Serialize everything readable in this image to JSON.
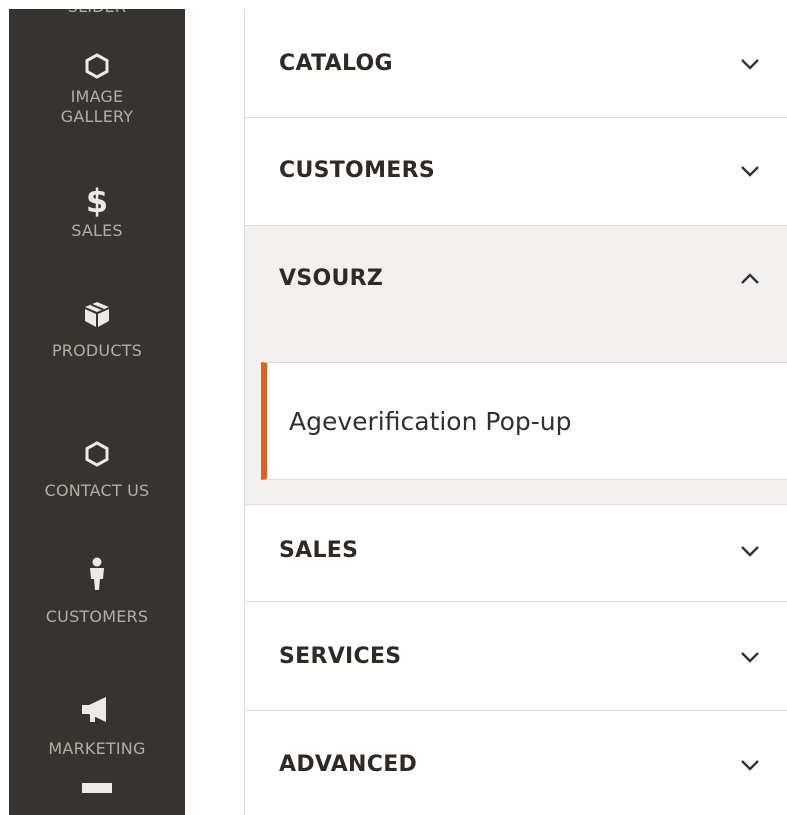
{
  "sidebar": {
    "items": [
      {
        "label": "SLIDER",
        "icon": "hexagon-icon"
      },
      {
        "label": "IMAGE GALLERY",
        "icon": "hexagon-icon"
      },
      {
        "label": "SALES",
        "icon": "dollar-icon"
      },
      {
        "label": "PRODUCTS",
        "icon": "box-icon"
      },
      {
        "label": "CONTACT US",
        "icon": "hexagon-icon"
      },
      {
        "label": "CUSTOMERS",
        "icon": "person-icon"
      },
      {
        "label": "MARKETING",
        "icon": "megaphone-icon"
      }
    ],
    "dollar_glyph": "$",
    "background": "#373330"
  },
  "config": {
    "sections": [
      {
        "title": "CATALOG",
        "expanded": false
      },
      {
        "title": "CUSTOMERS",
        "expanded": false
      },
      {
        "title": "VSOURZ",
        "expanded": true,
        "children": [
          {
            "label": "Ageverification Pop-up",
            "active": true
          }
        ]
      },
      {
        "title": "SALES",
        "expanded": false
      },
      {
        "title": "SERVICES",
        "expanded": false
      },
      {
        "title": "ADVANCED",
        "expanded": false
      }
    ],
    "accent_color": "#e0611f"
  }
}
